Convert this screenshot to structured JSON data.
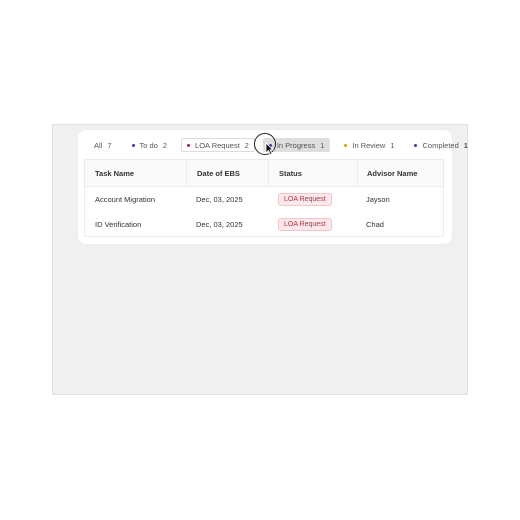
{
  "tabs": [
    {
      "label": "All",
      "count": "7",
      "dot_color": ""
    },
    {
      "label": "To do",
      "count": "2",
      "dot_color": "#3a3ab8"
    },
    {
      "label": "LOA Request",
      "count": "2",
      "dot_color": "#b3203a"
    },
    {
      "label": "In Progress",
      "count": "1",
      "dot_color": "#3a3ab8"
    },
    {
      "label": "In Review",
      "count": "1",
      "dot_color": "#d4a017"
    },
    {
      "label": "Completed",
      "count": "1",
      "dot_color": "#3a3ab8"
    }
  ],
  "selected_tab": "In Progress",
  "table": {
    "headers": [
      "Task Name",
      "Date of EBS",
      "Status",
      "Advisor Name"
    ],
    "rows": [
      {
        "task": "Account Migration",
        "date": "Dec, 03, 2025",
        "status": "LOA Request",
        "advisor": "Jayson"
      },
      {
        "task": "ID Verification",
        "date": "Dec, 03, 2025",
        "status": "LOA Request",
        "advisor": "Chad"
      }
    ]
  },
  "colors": {
    "status_badge_bg": "#fde9ec",
    "status_badge_text": "#b23445",
    "selected_tab_bg": "#dedede"
  }
}
